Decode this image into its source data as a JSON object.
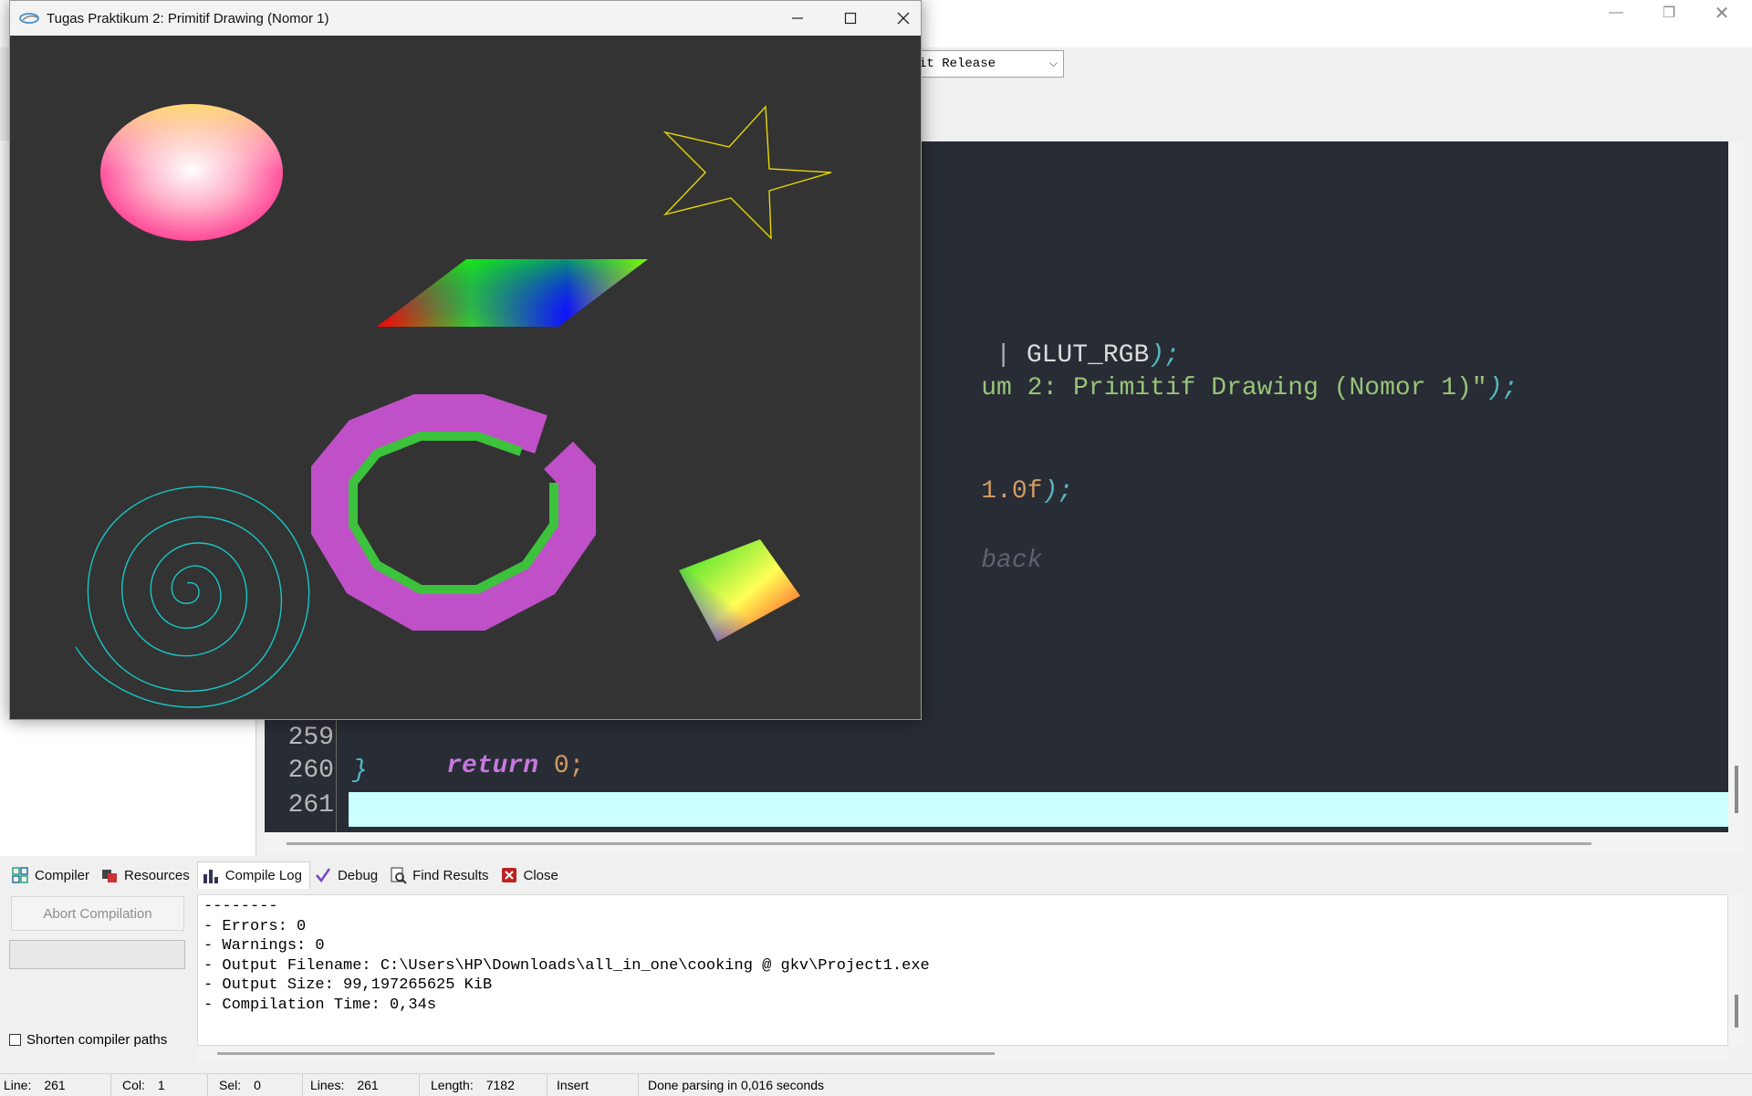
{
  "ide": {
    "build_config": "it Release",
    "window_controls": [
      "minimize",
      "restore",
      "close"
    ]
  },
  "editor": {
    "lines": [
      {
        "kind": "partial",
        "parts": [
          {
            "text": "| ",
            "color": "#abb2bf"
          },
          {
            "text": "GLUT_RGB",
            "color": "#dcdcdc"
          },
          {
            "text": ");",
            "color": "#56b6c2"
          }
        ]
      },
      {
        "kind": "partial",
        "parts": [
          {
            "text": "um 2: Primitif Drawing (Nomor 1)\"",
            "color": "#98c379"
          },
          {
            "text": ");",
            "color": "#56b6c2"
          }
        ]
      },
      {
        "kind": "partial",
        "parts": [
          {
            "text": "1.0f",
            "color": "#d19a66"
          },
          {
            "text": ");",
            "color": "#56b6c2"
          }
        ]
      },
      {
        "kind": "partial",
        "parts": [
          {
            "text": "back",
            "color": "#5c6370"
          }
        ]
      }
    ],
    "numbered_lines": [
      {
        "num": "259",
        "code": "return",
        "tail": "0;"
      },
      {
        "num": "260",
        "code": "}"
      },
      {
        "num": "261",
        "code": ""
      }
    ]
  },
  "bottom_tabs": [
    {
      "label": "Compiler",
      "icon": "compiler-icon"
    },
    {
      "label": "Resources",
      "icon": "resources-icon"
    },
    {
      "label": "Compile Log",
      "icon": "compile-log-icon",
      "active": true
    },
    {
      "label": "Debug",
      "icon": "debug-icon"
    },
    {
      "label": "Find Results",
      "icon": "find-results-icon"
    },
    {
      "label": "Close",
      "icon": "close-panel-icon"
    }
  ],
  "compile_panel": {
    "abort_label": "Abort Compilation",
    "shorten_label": "Shorten compiler paths",
    "log_lines": [
      "--------",
      "- Errors: 0",
      "- Warnings: 0",
      "- Output Filename: C:\\Users\\HP\\Downloads\\all_in_one\\cooking @ gkv\\Project1.exe",
      "- Output Size: 99,197265625 KiB",
      "- Compilation Time: 0,34s"
    ]
  },
  "status": {
    "line_label": "Line:",
    "line_value": "261",
    "col_label": "Col:",
    "col_value": "1",
    "sel_label": "Sel:",
    "sel_value": "0",
    "lines_label": "Lines:",
    "lines_value": "261",
    "length_label": "Length:",
    "length_value": "7182",
    "mode": "Insert",
    "message": "Done parsing in 0,016 seconds"
  },
  "gl_window": {
    "title": "Tugas Praktikum 2: Primitif Drawing (Nomor 1)",
    "background": "#333333",
    "shapes": [
      "ellipse",
      "star",
      "parallelogram",
      "ring",
      "spiral",
      "diamond"
    ]
  }
}
